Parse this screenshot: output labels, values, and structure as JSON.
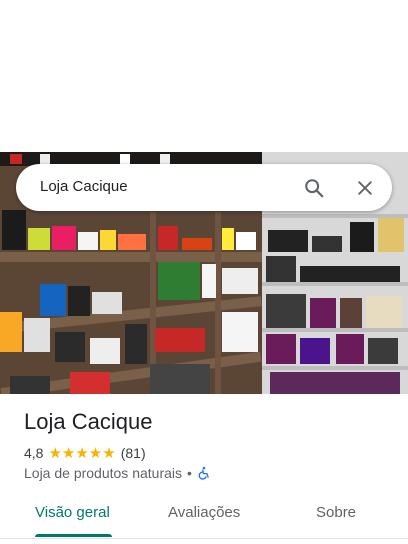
{
  "search": {
    "query": "Loja Cacique"
  },
  "place": {
    "name": "Loja Cacique",
    "rating": "4,8",
    "stars": "★★★★★",
    "reviews": "(81)",
    "category": "Loja de produtos naturais",
    "separator": "•"
  },
  "tabs": [
    {
      "label": "Visão geral",
      "active": true
    },
    {
      "label": "Avaliações"
    },
    {
      "label": "Sobre"
    }
  ],
  "colors": {
    "accent": "#00796b",
    "star": "#f5b400"
  },
  "icons": [
    "search-icon",
    "close-icon",
    "wheelchair-icon"
  ]
}
